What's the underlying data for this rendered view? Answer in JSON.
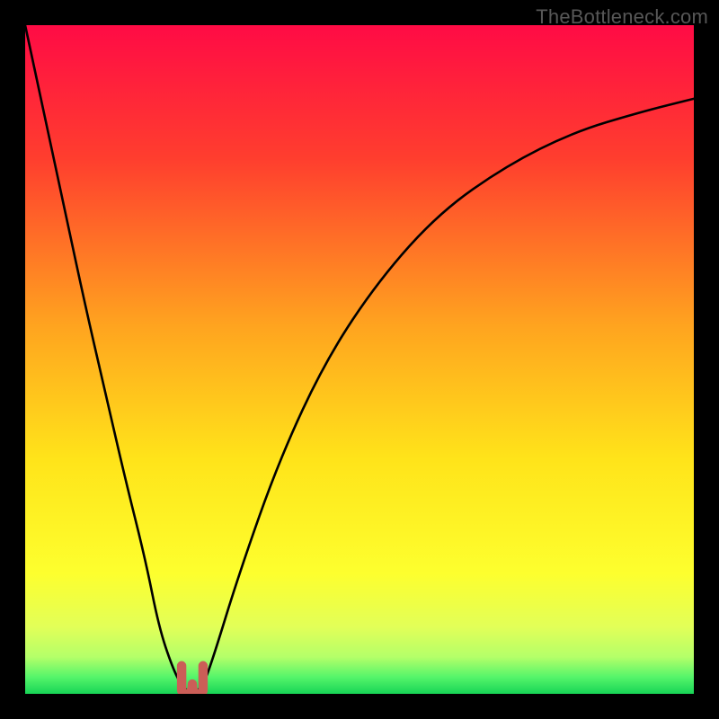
{
  "watermark": "TheBottleneck.com",
  "chart_data": {
    "type": "line",
    "title": "",
    "xlabel": "",
    "ylabel": "",
    "xlim": [
      0,
      100
    ],
    "ylim": [
      0,
      100
    ],
    "gradient_stops": [
      {
        "offset": 0,
        "color": "#ff0b45"
      },
      {
        "offset": 0.2,
        "color": "#ff3e2e"
      },
      {
        "offset": 0.45,
        "color": "#ffa41f"
      },
      {
        "offset": 0.65,
        "color": "#ffe41a"
      },
      {
        "offset": 0.82,
        "color": "#fdff2e"
      },
      {
        "offset": 0.9,
        "color": "#e2ff58"
      },
      {
        "offset": 0.945,
        "color": "#b4ff69"
      },
      {
        "offset": 0.975,
        "color": "#55f56a"
      },
      {
        "offset": 1.0,
        "color": "#17d456"
      }
    ],
    "series": [
      {
        "name": "bottleneck-curve",
        "x": [
          0,
          3,
          6,
          9,
          12,
          15,
          18,
          20,
          22,
          23.5,
          25,
          26.5,
          28,
          32,
          38,
          45,
          53,
          62,
          72,
          82,
          92,
          100
        ],
        "y": [
          100,
          86,
          72,
          58,
          45,
          32,
          20,
          10,
          4,
          1,
          0,
          1,
          5,
          18,
          35,
          50,
          62,
          72,
          79,
          84,
          87,
          89
        ]
      }
    ],
    "marker": {
      "name": "optimal-point-u-marker",
      "x_center": 25,
      "width": 3.2,
      "height": 4.2,
      "color": "#cb5e57"
    }
  }
}
